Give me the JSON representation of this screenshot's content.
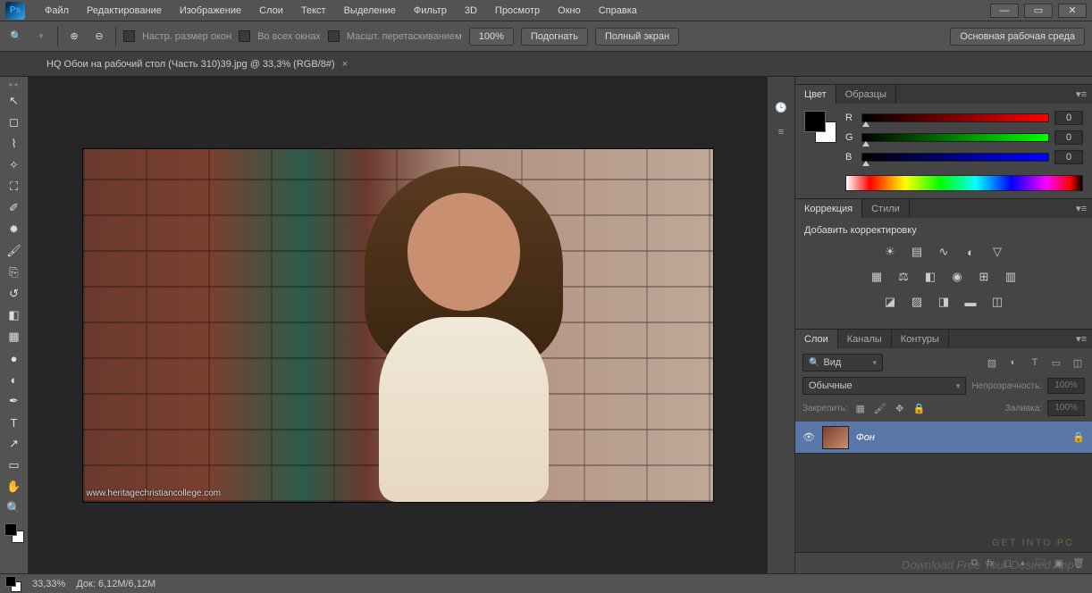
{
  "app": {
    "logo": "Ps"
  },
  "menu": [
    "Файл",
    "Редактирование",
    "Изображение",
    "Слои",
    "Текст",
    "Выделение",
    "Фильтр",
    "3D",
    "Просмотр",
    "Окно",
    "Справка"
  ],
  "options": {
    "resize_windows": "Настр. размер окон",
    "all_windows": "Во всех окнах",
    "scrubby_zoom": "Масшт. перетаскиванием",
    "zoom_pct": "100%",
    "fit": "Подогнать",
    "fullscreen": "Полный экран",
    "workspace": "Основная рабочая среда"
  },
  "document": {
    "tab_title": "HQ Обои на рабочий стол  (Часть 310)39.jpg @ 33,3% (RGB/8#)",
    "watermark_url": "www.heritagechristiancollege.com"
  },
  "panels": {
    "color": {
      "tabs": [
        "Цвет",
        "Образцы"
      ],
      "channels": [
        {
          "label": "R",
          "value": "0"
        },
        {
          "label": "G",
          "value": "0"
        },
        {
          "label": "B",
          "value": "0"
        }
      ]
    },
    "adjustments": {
      "tabs": [
        "Коррекция",
        "Стили"
      ],
      "title": "Добавить корректировку"
    },
    "layers": {
      "tabs": [
        "Слои",
        "Каналы",
        "Контуры"
      ],
      "filter_kind": "Вид",
      "blend_mode": "Обычные",
      "opacity_label": "Непрозрачность:",
      "opacity_value": "100%",
      "lock_label": "Закрепить:",
      "fill_label": "Заливка:",
      "fill_value": "100%",
      "layer_name": "Фон"
    }
  },
  "statusbar": {
    "zoom": "33,33%",
    "doc_size": "Док:  6,12M/6,12M"
  },
  "watermark": {
    "w1": "GET ",
    "w2": "INTO ",
    "w3": "PC",
    "sub": "Download Free Your Desired App"
  }
}
